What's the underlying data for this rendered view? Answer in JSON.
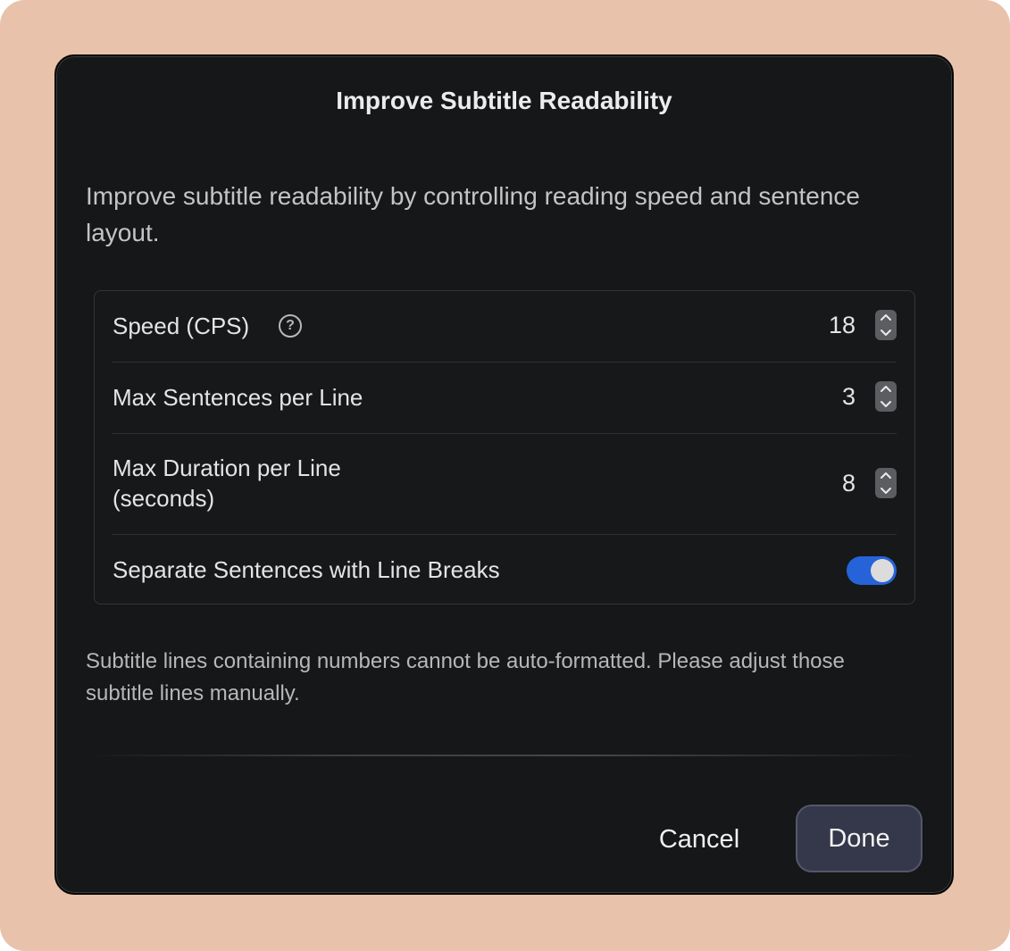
{
  "dialog": {
    "title": "Improve Subtitle Readability",
    "description": "Improve subtitle readability by controlling reading speed and sentence layout.",
    "settings": {
      "speed": {
        "label": "Speed (CPS)",
        "value": "18",
        "help_icon": "question-circle-icon"
      },
      "max_sentences": {
        "label": "Max Sentences per Line",
        "value": "3"
      },
      "max_duration": {
        "label_line1": "Max Duration per Line",
        "label_line2": "(seconds)",
        "value": "8"
      },
      "separate_sentences": {
        "label": "Separate Sentences with Line Breaks",
        "enabled": true
      }
    },
    "footnote": "Subtitle lines containing numbers cannot be auto-formatted. Please adjust those subtitle lines manually.",
    "buttons": {
      "cancel": "Cancel",
      "done": "Done"
    }
  },
  "colors": {
    "backdrop": "#e8c2aa",
    "dialog_bg": "#151718",
    "toggle_on": "#2663d9",
    "done_bg": "#35374a"
  }
}
